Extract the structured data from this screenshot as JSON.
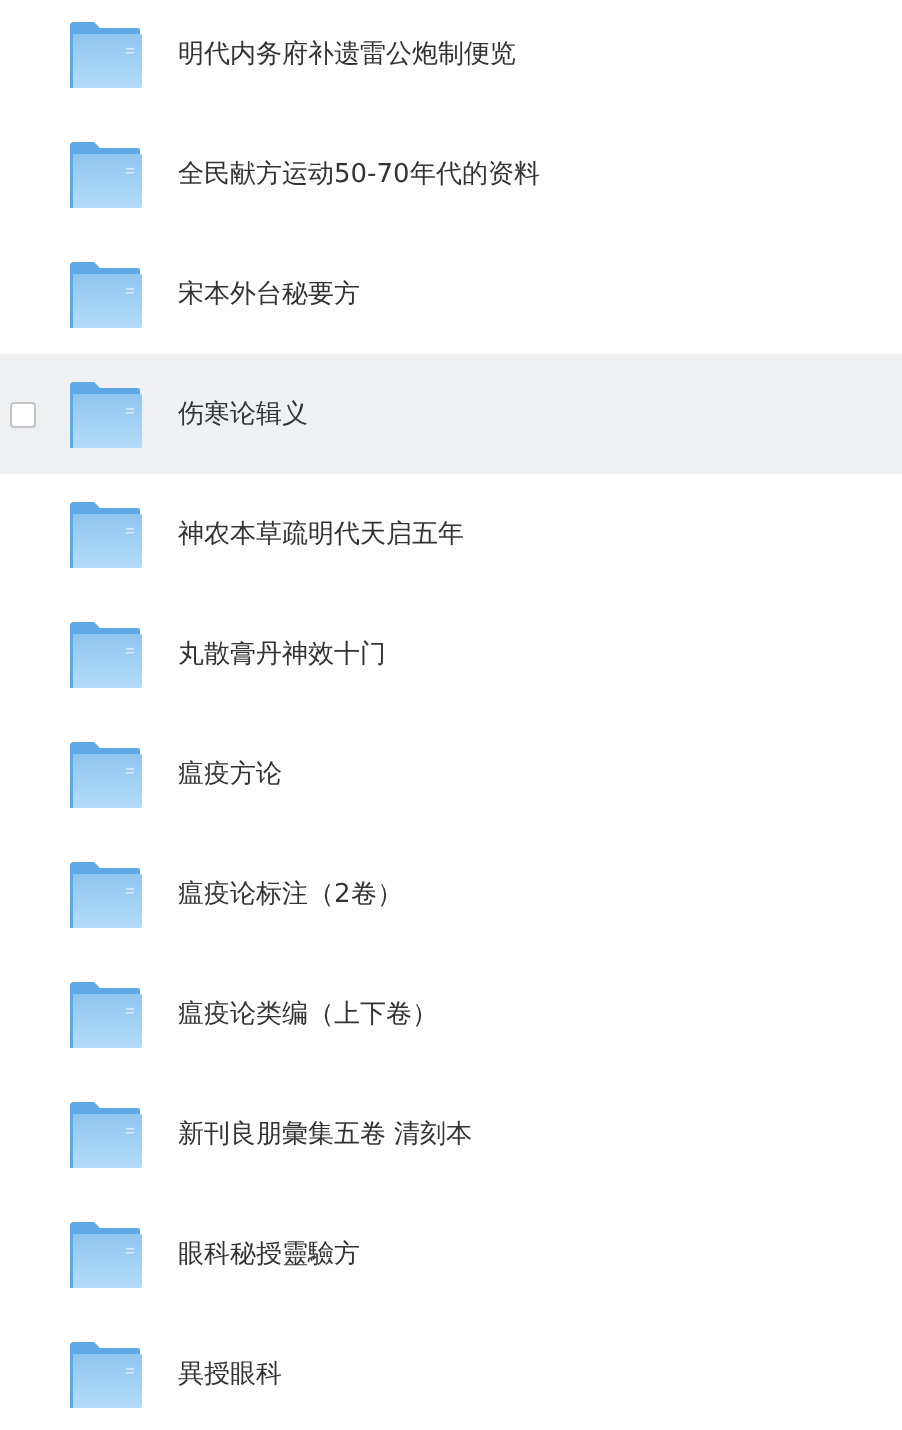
{
  "folders": [
    {
      "name": "明代内务府补遗雷公炮制便览",
      "highlighted": false
    },
    {
      "name": "全民献方运动50-70年代的资料",
      "highlighted": false
    },
    {
      "name": "宋本外台秘要方",
      "highlighted": false
    },
    {
      "name": "伤寒论辑义",
      "highlighted": true,
      "checked": false
    },
    {
      "name": "神农本草疏明代天启五年",
      "highlighted": false
    },
    {
      "name": "丸散膏丹神效十门",
      "highlighted": false
    },
    {
      "name": "瘟疫方论",
      "highlighted": false
    },
    {
      "name": "瘟疫论标注（2卷）",
      "highlighted": false
    },
    {
      "name": "瘟疫论类编（上下卷）",
      "highlighted": false
    },
    {
      "name": "新刊良朋彙集五卷 清刻本",
      "highlighted": false
    },
    {
      "name": "眼科秘授靈驗方",
      "highlighted": false
    },
    {
      "name": "異授眼科",
      "highlighted": false
    }
  ]
}
